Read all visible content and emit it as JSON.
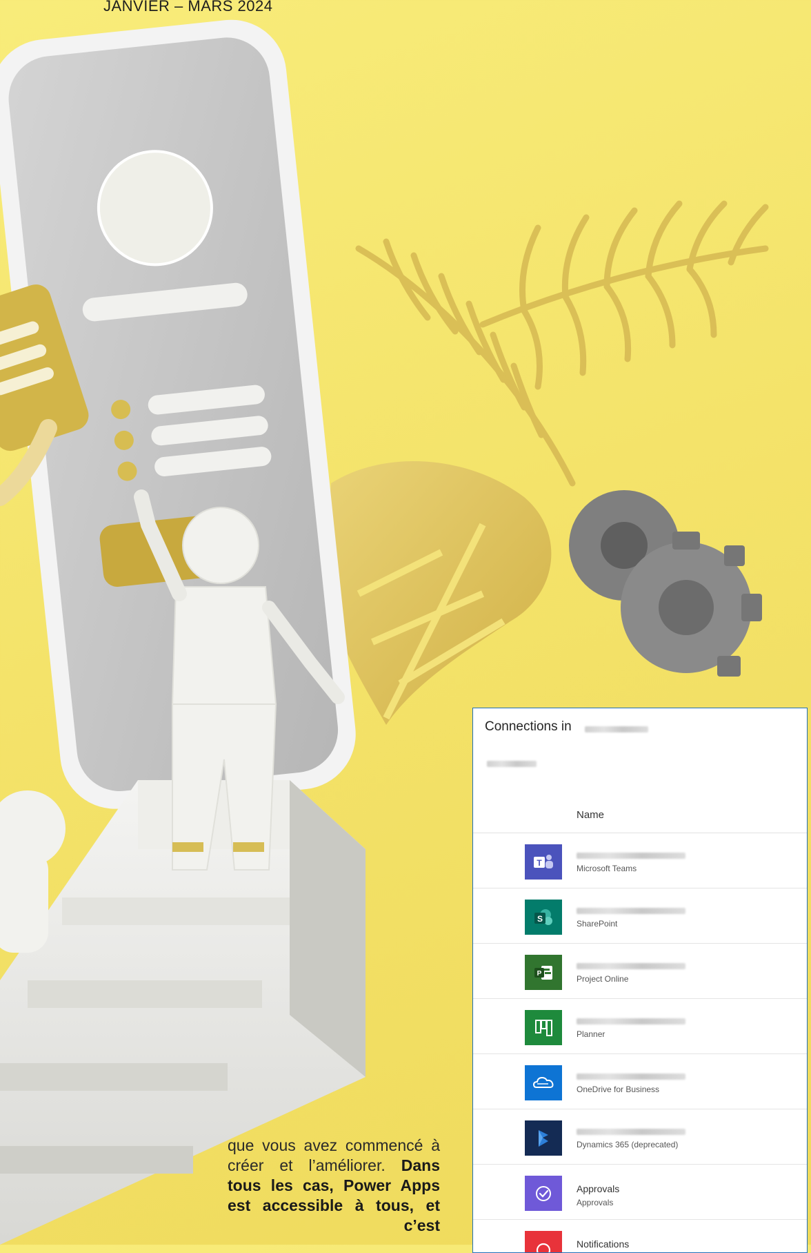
{
  "header": {
    "date": "JANVIER – MARS 2024"
  },
  "article": {
    "text_plain": "que vous avez commencé à créer et l’améliorer.",
    "text_bold": "Dans tous les cas, Power Apps est accessible à tous, et c’est"
  },
  "panel": {
    "title": "Connections in",
    "column_header": "Name",
    "rows": [
      {
        "name": "Microsoft Teams",
        "icon": "teams-icon",
        "color": "#4b53bc"
      },
      {
        "name": "SharePoint",
        "icon": "sharepoint-icon",
        "color": "#037c6b"
      },
      {
        "name": "Project Online",
        "icon": "project-icon",
        "color": "#31752f"
      },
      {
        "name": "Planner",
        "icon": "planner-icon",
        "color": "#1e8a3c"
      },
      {
        "name": "OneDrive for Business",
        "icon": "onedrive-icon",
        "color": "#0e74d4"
      },
      {
        "name": "Dynamics 365 (deprecated)",
        "icon": "dynamics-icon",
        "color": "#142b54"
      },
      {
        "title": "Approvals",
        "name": "Approvals",
        "icon": "approvals-icon",
        "color": "#6f59d8"
      },
      {
        "title": "Notifications",
        "icon": "notifications-icon",
        "color": "#e8333a"
      }
    ]
  }
}
